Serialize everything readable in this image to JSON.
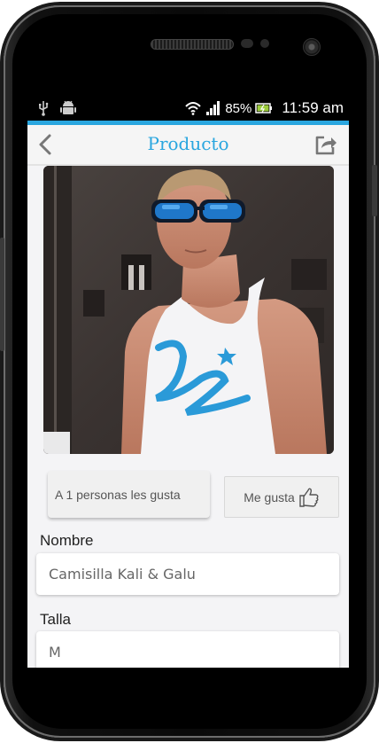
{
  "status_bar": {
    "battery": "85%",
    "time": "11:59 am",
    "icons": [
      "usb-icon",
      "android-debug-icon",
      "wifi-icon",
      "signal-icon",
      "battery-icon"
    ]
  },
  "app_bar": {
    "title": "Producto",
    "back_icon": "chevron-left-icon",
    "share_icon": "share-icon"
  },
  "product": {
    "likes_text": "A 1 personas les gusta",
    "like_button": "Me gusta",
    "fields": [
      {
        "label": "Nombre",
        "value": "Camisilla Kali & Galu"
      },
      {
        "label": "Talla",
        "value": "M"
      }
    ]
  },
  "colors": {
    "accent": "#2aa6df",
    "appbar_bg": "#f5f5f5",
    "content_bg": "#f4f4f6"
  }
}
